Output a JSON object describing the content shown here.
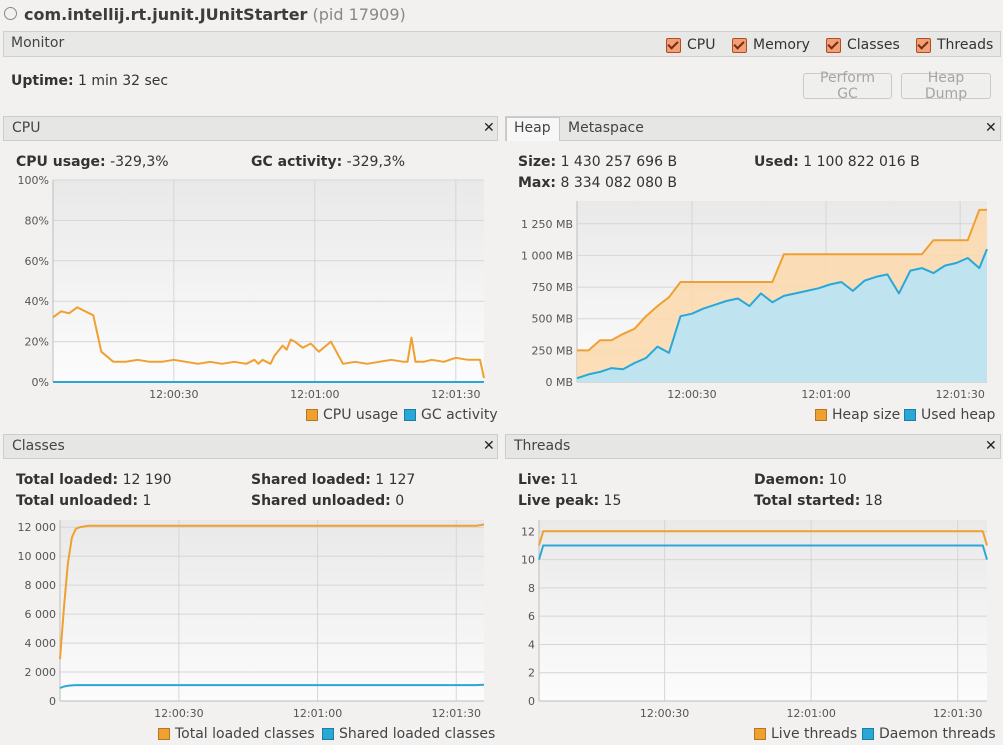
{
  "window": {
    "process_name": "com.intellij.rt.junit.JUnitStarter",
    "pid_text": "(pid 17909)"
  },
  "monitor": {
    "label": "Monitor",
    "checkboxes": [
      {
        "label": "CPU",
        "checked": true
      },
      {
        "label": "Memory",
        "checked": true
      },
      {
        "label": "Classes",
        "checked": true
      },
      {
        "label": "Threads",
        "checked": true
      }
    ],
    "uptime_label": "Uptime:",
    "uptime_value": "1 min 32 sec",
    "perform_gc_label": "Perform GC",
    "heap_dump_label": "Heap Dump"
  },
  "colors": {
    "orange": "#f0a030",
    "blue": "#29a8d8",
    "orange_fill": "#fbd9ad",
    "blue_fill": "#b8e4f6",
    "close": "#222222"
  },
  "cpu_panel": {
    "title": "CPU",
    "cpu_usage_label": "CPU usage:",
    "cpu_usage_value": "-329,3%",
    "gc_activity_label": "GC activity:",
    "gc_activity_value": "-329,3%"
  },
  "heap_panel": {
    "tabs": [
      "Heap",
      "Metaspace"
    ],
    "active_tab": "Heap",
    "size_label": "Size:",
    "size_value": "1 430 257 696 B",
    "used_label": "Used:",
    "used_value": "1 100 822 016 B",
    "max_label": "Max:",
    "max_value": "8 334 082 080 B"
  },
  "classes_panel": {
    "title": "Classes",
    "total_loaded_label": "Total loaded:",
    "total_loaded_value": "12 190",
    "total_unloaded_label": "Total unloaded:",
    "total_unloaded_value": "1",
    "shared_loaded_label": "Shared loaded:",
    "shared_loaded_value": "1 127",
    "shared_unloaded_label": "Shared unloaded:",
    "shared_unloaded_value": "0"
  },
  "threads_panel": {
    "title": "Threads",
    "live_label": "Live:",
    "live_value": "11",
    "live_peak_label": "Live peak:",
    "live_peak_value": "15",
    "daemon_label": "Daemon:",
    "daemon_value": "10",
    "total_started_label": "Total started:",
    "total_started_value": "18"
  },
  "chart_data": [
    {
      "type": "line",
      "x": [
        0,
        2,
        4,
        6,
        8,
        10,
        12,
        15,
        18,
        21,
        24,
        27,
        30,
        33,
        36,
        39,
        42,
        45,
        48,
        50,
        51,
        52,
        53,
        54,
        55,
        57,
        58,
        59,
        60,
        62,
        64,
        66,
        69,
        72,
        75,
        78,
        81,
        84,
        87,
        88,
        89,
        90,
        92,
        94,
        97,
        100,
        103,
        106,
        107
      ],
      "series": [
        {
          "name": "CPU usage",
          "color": "#f0a030",
          "values": [
            32,
            35,
            34,
            37,
            35,
            33,
            15,
            10,
            10,
            11,
            10,
            10,
            11,
            10,
            9,
            10,
            9,
            10,
            9,
            11,
            9,
            11,
            10,
            9,
            13,
            18,
            16,
            21,
            20,
            17,
            19,
            15,
            20,
            9,
            10,
            9,
            10,
            11,
            10,
            10,
            22,
            10,
            10,
            11,
            10,
            12,
            11,
            11,
            2
          ]
        },
        {
          "name": "GC activity",
          "color": "#29a8d8",
          "values": [
            0,
            0,
            0,
            0,
            0,
            0,
            0,
            0,
            0,
            0,
            0,
            0,
            0,
            0,
            0,
            0,
            0,
            0,
            0,
            0,
            0,
            0,
            0,
            0,
            0,
            0,
            0,
            0,
            0,
            0,
            0,
            0,
            0,
            0,
            0,
            0,
            0,
            0,
            0,
            0,
            0,
            0,
            0,
            0,
            0,
            0,
            0,
            0,
            0
          ]
        }
      ],
      "x_ticks": [
        "12:00:30",
        "12:01:00",
        "12:01:30"
      ],
      "y_ticks": [
        "0%",
        "20%",
        "40%",
        "60%",
        "80%",
        "100%"
      ],
      "ylim": [
        0,
        100
      ],
      "grid": true
    },
    {
      "type": "area",
      "x": [
        0,
        3,
        6,
        9,
        12,
        15,
        18,
        21,
        24,
        27,
        30,
        33,
        36,
        39,
        42,
        45,
        48,
        51,
        54,
        57,
        60,
        63,
        66,
        69,
        72,
        75,
        78,
        81,
        84,
        87,
        90,
        93,
        96,
        99,
        102,
        105,
        107
      ],
      "series": [
        {
          "name": "Heap size",
          "color": "#f0a030",
          "values": [
            250,
            250,
            330,
            330,
            380,
            420,
            520,
            600,
            670,
            790,
            790,
            790,
            790,
            790,
            790,
            790,
            790,
            790,
            1010,
            1010,
            1010,
            1010,
            1010,
            1010,
            1010,
            1010,
            1010,
            1010,
            1010,
            1010,
            1010,
            1120,
            1120,
            1120,
            1120,
            1360,
            1360
          ]
        },
        {
          "name": "Used heap",
          "color": "#29a8d8",
          "values": [
            30,
            60,
            80,
            110,
            100,
            150,
            190,
            280,
            230,
            520,
            540,
            580,
            610,
            640,
            660,
            600,
            700,
            630,
            680,
            700,
            720,
            740,
            770,
            790,
            720,
            800,
            830,
            850,
            700,
            880,
            900,
            860,
            920,
            940,
            980,
            900,
            1050
          ]
        }
      ],
      "x_ticks": [
        "12:00:30",
        "12:01:00",
        "12:01:30"
      ],
      "y_ticks": [
        "0 MB",
        "250 MB",
        "500 MB",
        "750 MB",
        "1 000 MB",
        "1 250 MB"
      ],
      "ylim": [
        0,
        1430
      ],
      "grid": true
    },
    {
      "type": "line",
      "x": [
        0,
        1,
        2,
        3,
        4,
        5,
        6,
        7,
        8,
        10,
        15,
        20,
        40,
        60,
        80,
        100,
        105,
        107
      ],
      "series": [
        {
          "name": "Total loaded classes",
          "color": "#f0a030",
          "values": [
            2900,
            6500,
            9500,
            11300,
            11900,
            12000,
            12050,
            12100,
            12100,
            12100,
            12100,
            12100,
            12100,
            12100,
            12100,
            12100,
            12100,
            12190
          ]
        },
        {
          "name": "Shared loaded classes",
          "color": "#29a8d8",
          "values": [
            900,
            1000,
            1050,
            1080,
            1100,
            1100,
            1100,
            1100,
            1100,
            1100,
            1100,
            1100,
            1100,
            1100,
            1100,
            1100,
            1100,
            1127
          ]
        }
      ],
      "x_ticks": [
        "12:00:30",
        "12:01:00",
        "12:01:30"
      ],
      "y_ticks": [
        "0",
        "2 000",
        "4 000",
        "6 000",
        "8 000",
        "10 000",
        "12 000"
      ],
      "ylim": [
        0,
        12500
      ],
      "grid": true
    },
    {
      "type": "line",
      "x": [
        0,
        1,
        2,
        10,
        40,
        70,
        100,
        104,
        106,
        107
      ],
      "series": [
        {
          "name": "Live threads",
          "color": "#f0a030",
          "values": [
            11,
            12,
            12,
            12,
            12,
            12,
            12,
            12,
            12,
            11
          ]
        },
        {
          "name": "Daemon threads",
          "color": "#29a8d8",
          "values": [
            10,
            11,
            11,
            11,
            11,
            11,
            11,
            11,
            11,
            10
          ]
        }
      ],
      "x_ticks": [
        "12:00:30",
        "12:01:00",
        "12:01:30"
      ],
      "y_ticks": [
        "0",
        "2",
        "4",
        "6",
        "8",
        "10",
        "12"
      ],
      "ylim": [
        0,
        12.8
      ],
      "grid": true
    }
  ]
}
